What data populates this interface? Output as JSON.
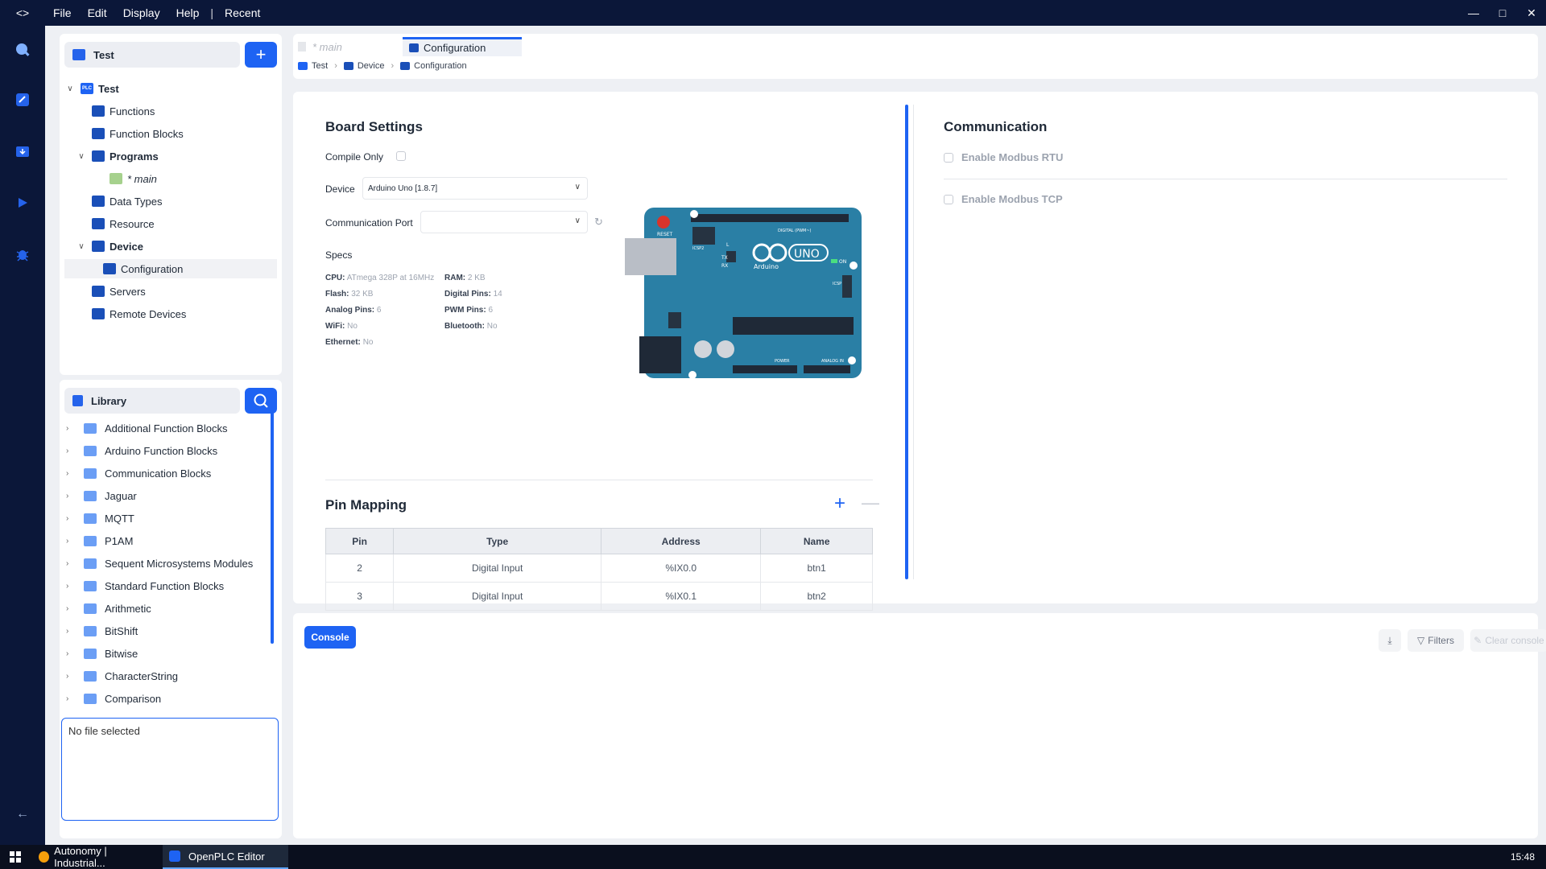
{
  "titlebar": {
    "menus": [
      "File",
      "Edit",
      "Display",
      "Help"
    ],
    "separator": "|",
    "recent": "Recent"
  },
  "project": {
    "header": "Test",
    "tree": [
      {
        "label": "Test",
        "level": 0,
        "expanded": true,
        "bold": true
      },
      {
        "label": "Functions",
        "level": 1
      },
      {
        "label": "Function Blocks",
        "level": 1
      },
      {
        "label": "Programs",
        "level": 1,
        "expanded": true,
        "bold": true
      },
      {
        "label": "* main",
        "level": 2
      },
      {
        "label": "Data Types",
        "level": 1
      },
      {
        "label": "Resource",
        "level": 1
      },
      {
        "label": "Device",
        "level": 1,
        "expanded": true,
        "bold": true
      },
      {
        "label": "Configuration",
        "level": 2,
        "selected": true
      },
      {
        "label": "Servers",
        "level": 1
      },
      {
        "label": "Remote Devices",
        "level": 1
      }
    ]
  },
  "library": {
    "header": "Library",
    "items": [
      "Additional Function Blocks",
      "Arduino Function Blocks",
      "Communication Blocks",
      "Jaguar",
      "MQTT",
      "P1AM",
      "Sequent Microsystems Modules",
      "Standard Function Blocks",
      "Arithmetic",
      "BitShift",
      "Bitwise",
      "CharacterString",
      "Comparison"
    ],
    "file_status": "No file selected"
  },
  "tabs": {
    "main": "* main",
    "config": "Configuration"
  },
  "breadcrumb": [
    "Test",
    "Device",
    "Configuration"
  ],
  "board": {
    "title": "Board Settings",
    "compile_only": "Compile Only",
    "device_label": "Device",
    "device_value": "Arduino Uno [1.8.7]",
    "port_label": "Communication Port",
    "port_value": "",
    "specs_title": "Specs",
    "specs": {
      "cpu_k": "CPU:",
      "cpu_v": "ATmega 328P at 16MHz",
      "ram_k": "RAM:",
      "ram_v": "2 KB",
      "flash_k": "Flash:",
      "flash_v": "32 KB",
      "dpins_k": "Digital Pins:",
      "dpins_v": "14",
      "apins_k": "Analog Pins:",
      "apins_v": "6",
      "pwm_k": "PWM Pins:",
      "pwm_v": "6",
      "wifi_k": "WiFi:",
      "wifi_v": "No",
      "bt_k": "Bluetooth:",
      "bt_v": "No",
      "eth_k": "Ethernet:",
      "eth_v": "No"
    },
    "board_text": {
      "uno": "UNO",
      "arduino": "Arduino",
      "reset": "RESET",
      "on": "ON",
      "tx": "TX",
      "rx": "RX",
      "l": "L",
      "icsp": "ICSP",
      "icsp2": "ICSP2",
      "power": "POWER",
      "analog": "ANALOG IN",
      "digital": "DIGITAL (PWM~)"
    }
  },
  "communication": {
    "title": "Communication",
    "modbus_rtu": "Enable Modbus RTU",
    "modbus_tcp": "Enable Modbus TCP"
  },
  "pin_mapping": {
    "title": "Pin Mapping",
    "columns": [
      "Pin",
      "Type",
      "Address",
      "Name"
    ],
    "rows": [
      [
        "2",
        "Digital Input",
        "%IX0.0",
        "btn1"
      ],
      [
        "3",
        "Digital Input",
        "%IX0.1",
        "btn2"
      ]
    ]
  },
  "console": {
    "button": "Console",
    "filters": "Filters",
    "clear": "Clear console"
  },
  "taskbar": {
    "task1": "Autonomy | Industrial...",
    "task2": "OpenPLC Editor",
    "clock": "15:48"
  },
  "colors": {
    "accent": "#1e63f3",
    "titlebar": "#0b1739",
    "board": "#2a7fa5"
  }
}
